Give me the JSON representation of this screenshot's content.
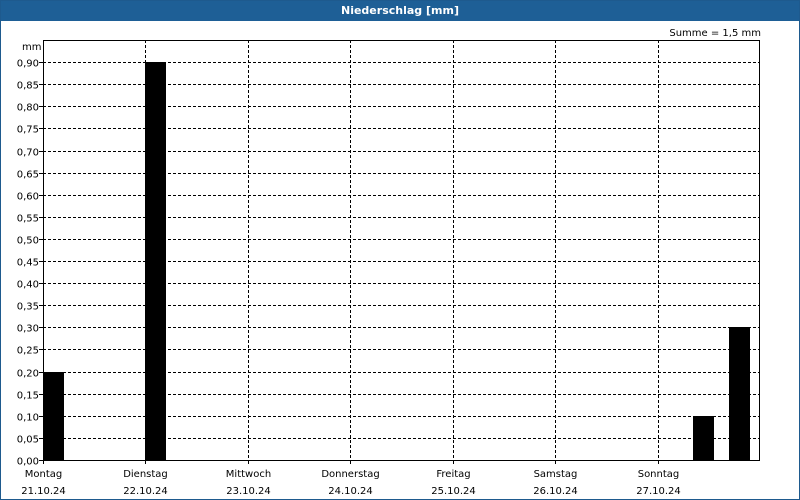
{
  "window": {
    "title": "Niederschlag [mm]"
  },
  "colors": {
    "titlebar": "#1e5f96",
    "bars": "#000000",
    "grid": "#000000"
  },
  "chart_data": {
    "type": "bar",
    "title": "Niederschlag [mm]",
    "ylabel": "mm",
    "summary": "Summe = 1,5 mm",
    "ylim": [
      0,
      0.95
    ],
    "yticks": [
      0,
      0.05,
      0.1,
      0.15,
      0.2,
      0.25,
      0.3,
      0.35,
      0.4,
      0.45,
      0.5,
      0.55,
      0.6,
      0.65,
      0.7,
      0.75,
      0.8,
      0.85,
      0.9
    ],
    "ytick_labels": [
      "0,00",
      "0,05",
      "0,10",
      "0,15",
      "0,20",
      "0,25",
      "0,30",
      "0,35",
      "0,40",
      "0,45",
      "0,50",
      "0,55",
      "0,60",
      "0,65",
      "0,70",
      "0,75",
      "0,80",
      "0,85",
      "0,90"
    ],
    "days": [
      {
        "day": "Montag",
        "date": "21.10.24"
      },
      {
        "day": "Dienstag",
        "date": "22.10.24"
      },
      {
        "day": "Mittwoch",
        "date": "23.10.24"
      },
      {
        "day": "Donnerstag",
        "date": "24.10.24"
      },
      {
        "day": "Freitag",
        "date": "25.10.24"
      },
      {
        "day": "Samstag",
        "date": "26.10.24"
      },
      {
        "day": "Sonntag",
        "date": "27.10.24"
      }
    ],
    "x_range_days": [
      0,
      7
    ],
    "bars": [
      {
        "x_day": 0.0,
        "value": 0.2
      },
      {
        "x_day": 1.0,
        "value": 0.9
      },
      {
        "x_day": 6.35,
        "value": 0.1
      },
      {
        "x_day": 6.7,
        "value": 0.3
      }
    ],
    "grid": true
  }
}
